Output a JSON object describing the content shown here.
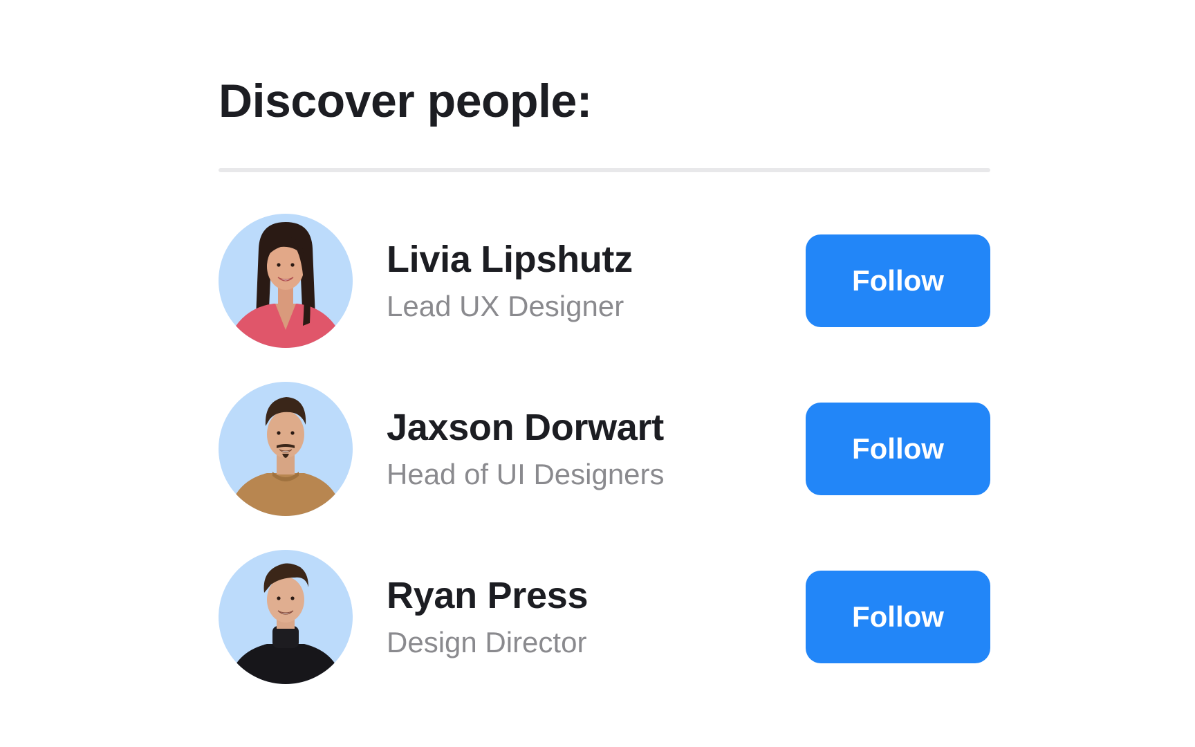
{
  "header": {
    "title": "Discover people:"
  },
  "colors": {
    "accent": "#2286f8",
    "avatar_background": "#bcdbfb",
    "name_text": "#1c1d22",
    "role_text": "#8a8a8e",
    "divider": "#e8e8ea"
  },
  "people": [
    {
      "name": "Livia Lipshutz",
      "role": "Lead UX Designer",
      "action_label": "Follow",
      "avatar": "woman-portrait-photo"
    },
    {
      "name": "Jaxson Dorwart",
      "role": "Head of UI Designers",
      "action_label": "Follow",
      "avatar": "man-portrait-photo"
    },
    {
      "name": "Ryan Press",
      "role": "Design Director",
      "action_label": "Follow",
      "avatar": "man-portrait-photo"
    }
  ]
}
